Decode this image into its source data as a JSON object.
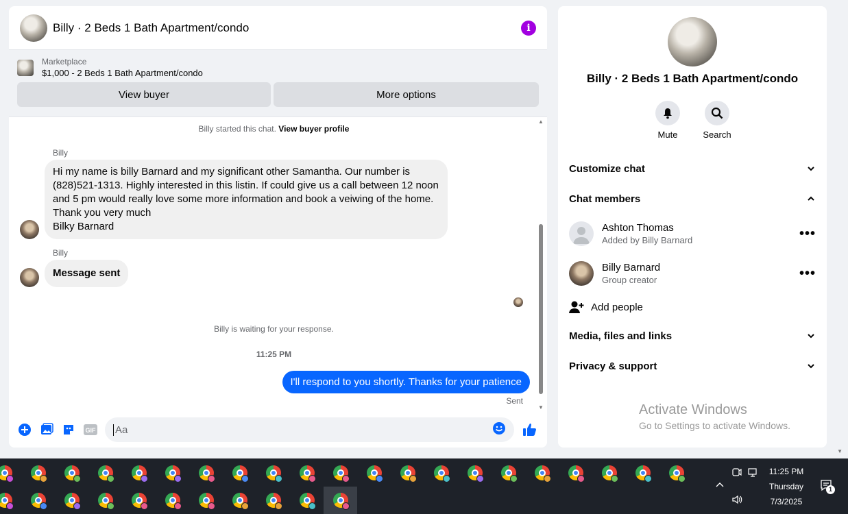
{
  "chat": {
    "title": "Billy · 2 Beds 1 Bath Apartment/condo",
    "listing": {
      "label": "Marketplace",
      "price_title": "$1,000 - 2 Beds 1 Bath Apartment/condo",
      "view_buyer": "View buyer",
      "more_options": "More options"
    },
    "system_start_prefix": "Billy started this chat.",
    "system_start_link": "View buyer profile",
    "messages": [
      {
        "sender": "Billy",
        "lines": [
          "Hi my name is billy Barnard and my significant other Samantha. Our number is",
          "(828)521-1313. Highly interested in this listin. If could give us a call between 12 noon",
          "and 5 pm would really love some more information and book a veiwing of the home.",
          "Thank you very much",
          "Bilky Barnard"
        ]
      },
      {
        "sender": "Billy",
        "text": "Message sent"
      }
    ],
    "waiting_note": "Billy is waiting for your response.",
    "timestamp": "11:25 PM",
    "outgoing": "I'll respond to you shortly. Thanks for your patience",
    "outgoing_status": "Sent",
    "composer_placeholder": "Aa"
  },
  "info_panel": {
    "title": "Billy · 2 Beds 1 Bath Apartment/condo",
    "actions": {
      "mute": "Mute",
      "search": "Search"
    },
    "sections": {
      "customize": "Customize chat",
      "members": "Chat members",
      "media": "Media, files and links",
      "privacy": "Privacy & support"
    },
    "members": [
      {
        "name": "Ashton Thomas",
        "sub": "Added by Billy Barnard"
      },
      {
        "name": "Billy Barnard",
        "sub": "Group creator"
      }
    ],
    "add_people": "Add people",
    "activate_title": "Activate Windows",
    "activate_sub": "Go to Settings to activate Windows."
  },
  "taskbar": {
    "time": "11:25 PM",
    "day": "Thursday",
    "date": "7/3/2025",
    "notification_count": "1",
    "row1_badges": [
      "#c84fd8",
      "#e8a33a",
      "#6cbf5a",
      "#6cbf5a",
      "#9b6cf0",
      "#9b6cf0",
      "#e85a8c",
      "#4a8af4",
      "#4ac0c9",
      "#e85a8c",
      "#e85a8c",
      "#4a8af4",
      "#e8a33a",
      "#4ac0c9",
      "#9b6cf0",
      "#6cbf5a",
      "#e8a33a",
      "#e85a8c",
      "#6cbf5a",
      "#4ac0c9",
      "#6cbf5a"
    ],
    "row2_badges": [
      "#c84fd8",
      "#4a8af4",
      "#9b6cf0",
      "#6cbf5a",
      "#e85a8c",
      "#e85a8c",
      "#e85a8c",
      "#e8a33a",
      "#e8a33a",
      "#4ac0c9",
      "#e85a8c"
    ]
  }
}
